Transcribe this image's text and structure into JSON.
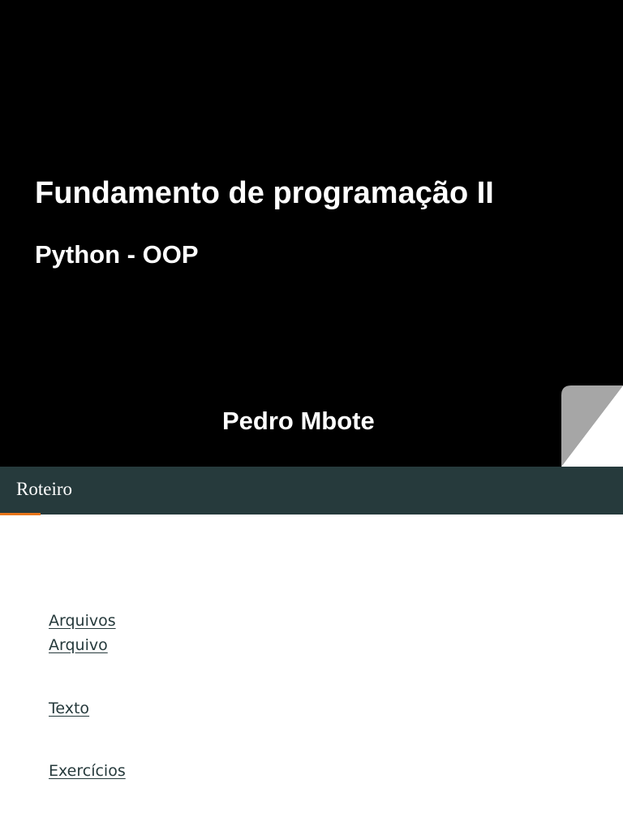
{
  "title_slide": {
    "title": "Fundamento de programação II",
    "subtitle": "Python - OOP",
    "author": "Pedro Mbote",
    "background_color": "#000000",
    "curl_color": "#a6a6a6"
  },
  "outline_slide": {
    "header_title": "Roteiro",
    "header_color": "#263a3c",
    "accent_color": "#e8751a",
    "links": [
      {
        "label": "Arquivos"
      },
      {
        "label": "Arquivo"
      },
      {
        "label": "Texto"
      },
      {
        "label": "Exercícios"
      }
    ]
  }
}
